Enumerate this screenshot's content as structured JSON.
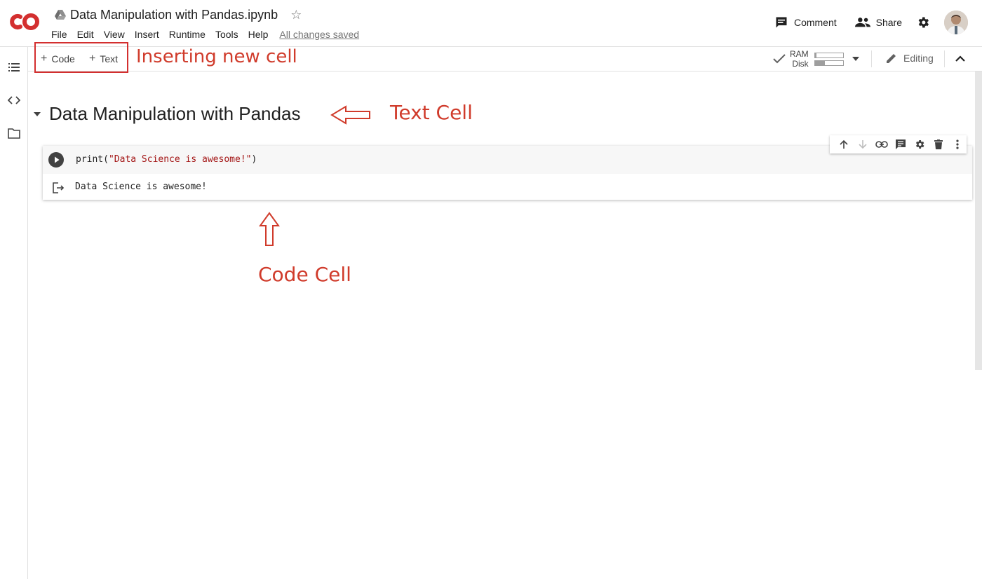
{
  "app": {
    "logo_text": "CO",
    "notebook_title": "Data Manipulation with Pandas.ipynb",
    "saved_status": "All changes saved"
  },
  "menu": [
    "File",
    "Edit",
    "View",
    "Insert",
    "Runtime",
    "Tools",
    "Help"
  ],
  "header_actions": {
    "comment_label": "Comment",
    "share_label": "Share"
  },
  "toolbar": {
    "add_code_label": "Code",
    "add_text_label": "Text",
    "ram_label": "RAM",
    "disk_label": "Disk",
    "ram_usage": 0.05,
    "disk_usage": 0.35,
    "editing_label": "Editing"
  },
  "notebook": {
    "section_title": "Data Manipulation with Pandas",
    "code_fn": "print(",
    "code_string": "\"Data Science is awesome!\"",
    "code_close": ")",
    "output": "Data Science is awesome!"
  },
  "annotations": {
    "inserting": "Inserting new cell",
    "text_cell": "Text Cell",
    "code_cell": "Code Cell"
  },
  "colors": {
    "annotation": "#d03b2b",
    "logo": "#d32f2f"
  },
  "icons": {
    "sidebar": [
      "toc-icon",
      "code-snippets-icon",
      "folder-icon"
    ],
    "cell_toolbar": [
      "move-up-icon",
      "move-down-icon",
      "link-icon",
      "comment-icon",
      "settings-icon",
      "delete-icon",
      "more-icon"
    ]
  }
}
